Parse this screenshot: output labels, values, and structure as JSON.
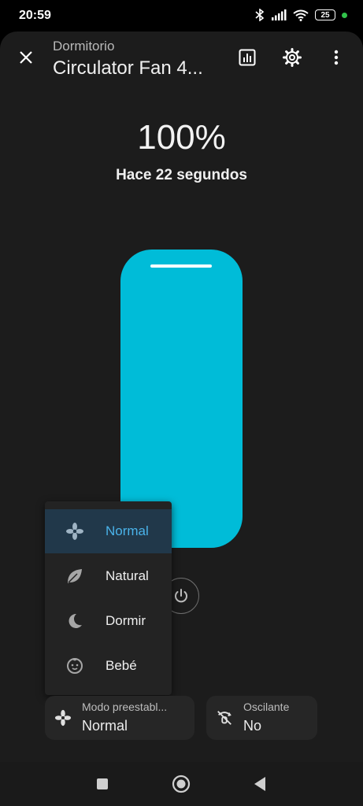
{
  "status_bar": {
    "time": "20:59",
    "battery": "25"
  },
  "header": {
    "room": "Dormitorio",
    "device_name": "Circulator Fan 4..."
  },
  "state": {
    "percentage": "100%",
    "percentage_value": 1.0,
    "last_changed": "Hace 22 segundos"
  },
  "preset_menu": {
    "items": [
      {
        "label": "Normal",
        "icon": "fan-icon",
        "selected": true
      },
      {
        "label": "Natural",
        "icon": "leaf-icon",
        "selected": false
      },
      {
        "label": "Dormir",
        "icon": "moon-icon",
        "selected": false
      },
      {
        "label": "Bebé",
        "icon": "baby-face-icon",
        "selected": false
      }
    ]
  },
  "cards": {
    "preset": {
      "label": "Modo preestabl...",
      "value": "Normal",
      "icon": "fan-icon"
    },
    "oscillate": {
      "label": "Oscilante",
      "value": "No",
      "icon": "oscillate-off-icon"
    }
  },
  "colors": {
    "accent": "#00bcd8",
    "selected_text": "#4ab3ea",
    "selected_bg": "#21384a",
    "sheet_bg": "#1c1c1c"
  }
}
